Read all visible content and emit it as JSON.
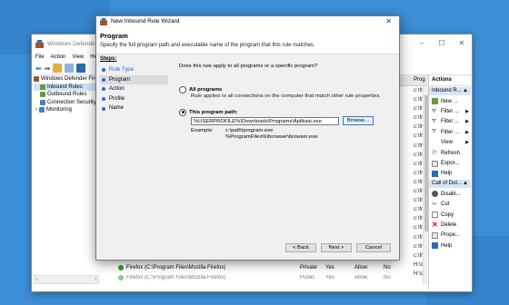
{
  "firewall": {
    "title": "Windows Defender Fire",
    "menu": [
      "File",
      "Action",
      "View",
      "He"
    ],
    "tree": [
      {
        "label": "Windows Defender Firew",
        "icon": "firewall-icon"
      },
      {
        "label": "Inbound Rules",
        "icon": "inbound-rules-icon"
      },
      {
        "label": "Outbound Rules",
        "icon": "outbound-rules-icon"
      },
      {
        "label": "Connection Security",
        "icon": "connection-security-icon"
      },
      {
        "label": "Monitoring",
        "icon": "monitoring-icon"
      }
    ],
    "column_header": "Prog",
    "program_col": [
      "c:\\fr",
      "c:\\fr",
      "c:\\fr",
      "c:\\fr",
      "c:\\fr",
      "c:\\fr",
      "c:\\fr",
      "c:\\fr",
      "c:\\fr",
      "c:\\fr",
      "c:\\fr",
      "c:\\fr",
      "c:\\fr",
      "c:\\fr",
      "c:\\fr",
      "c:\\fr",
      "c:\\fr",
      "c:\\fr",
      "c:\\fr",
      "H:\\c",
      "H:\\c",
      "C:\\P",
      "C:\\P"
    ],
    "bottom_row": {
      "name": "Firefox (C:\\Program Files\\Mozilla Firefox)",
      "profile": "Private",
      "enabled": "Yes",
      "action": "Allow",
      "override": "No",
      "program": "C:\\P"
    },
    "bottom_row2": {
      "name": "Firefox (C:\\Program Files\\Mozilla Firefox)",
      "profile": "Public",
      "enabled": "Yes",
      "action": "Allow",
      "override": "No",
      "program": "C:\\P"
    },
    "actions": {
      "header": "Actions",
      "section1": "Inbound R...",
      "items1": [
        {
          "label": "New ...",
          "icon": "new-rule-icon"
        },
        {
          "label": "Filter ...",
          "icon": "filter-icon"
        },
        {
          "label": "Filter ...",
          "icon": "filter-icon"
        },
        {
          "label": "Filter ...",
          "icon": "filter-icon"
        },
        {
          "label": "View",
          "icon": "view-icon"
        },
        {
          "label": "Refresh",
          "icon": "refresh-icon"
        },
        {
          "label": "Expor...",
          "icon": "export-icon"
        },
        {
          "label": "Help",
          "icon": "help-icon"
        }
      ],
      "section2": "Call of Dut...",
      "items2": [
        {
          "label": "Disabl...",
          "icon": "disable-icon"
        },
        {
          "label": "Cut",
          "icon": "cut-icon"
        },
        {
          "label": "Copy",
          "icon": "copy-icon"
        },
        {
          "label": "Delete",
          "icon": "delete-icon"
        },
        {
          "label": "Prope...",
          "icon": "properties-icon"
        },
        {
          "label": "Help",
          "icon": "help-icon"
        }
      ]
    }
  },
  "wizard": {
    "title": "New Inbound Rule Wizard",
    "heading": "Program",
    "subheading": "Specify the full program path and executable name of the program that this rule matches.",
    "steps_header": "Steps:",
    "steps": [
      "Rule Type",
      "Program",
      "Action",
      "Profile",
      "Name"
    ],
    "current_step": "Program",
    "question": "Does this rule apply to all programs or a specific program?",
    "all_programs_label": "All programs",
    "all_programs_desc": "Rule applies to all connections on the computer that match other rule properties.",
    "this_program_label": "This program path:",
    "path_value": "%USERPROFILE%\\Downloads\\Programs\\Aplikasi.exe",
    "browse_label": "Browse...",
    "example_label": "Example:",
    "example_values": [
      "c:\\path\\program.exe",
      "%ProgramFiles%\\browser\\browser.exe"
    ],
    "back_label": "< Back",
    "next_label": "Next >",
    "cancel_label": "Cancel"
  },
  "colors": {
    "desktop": "#3c8ed6",
    "accent": "#1e6fc8",
    "selection": "#cce4f7",
    "actions_section": "#d6e6f5"
  }
}
